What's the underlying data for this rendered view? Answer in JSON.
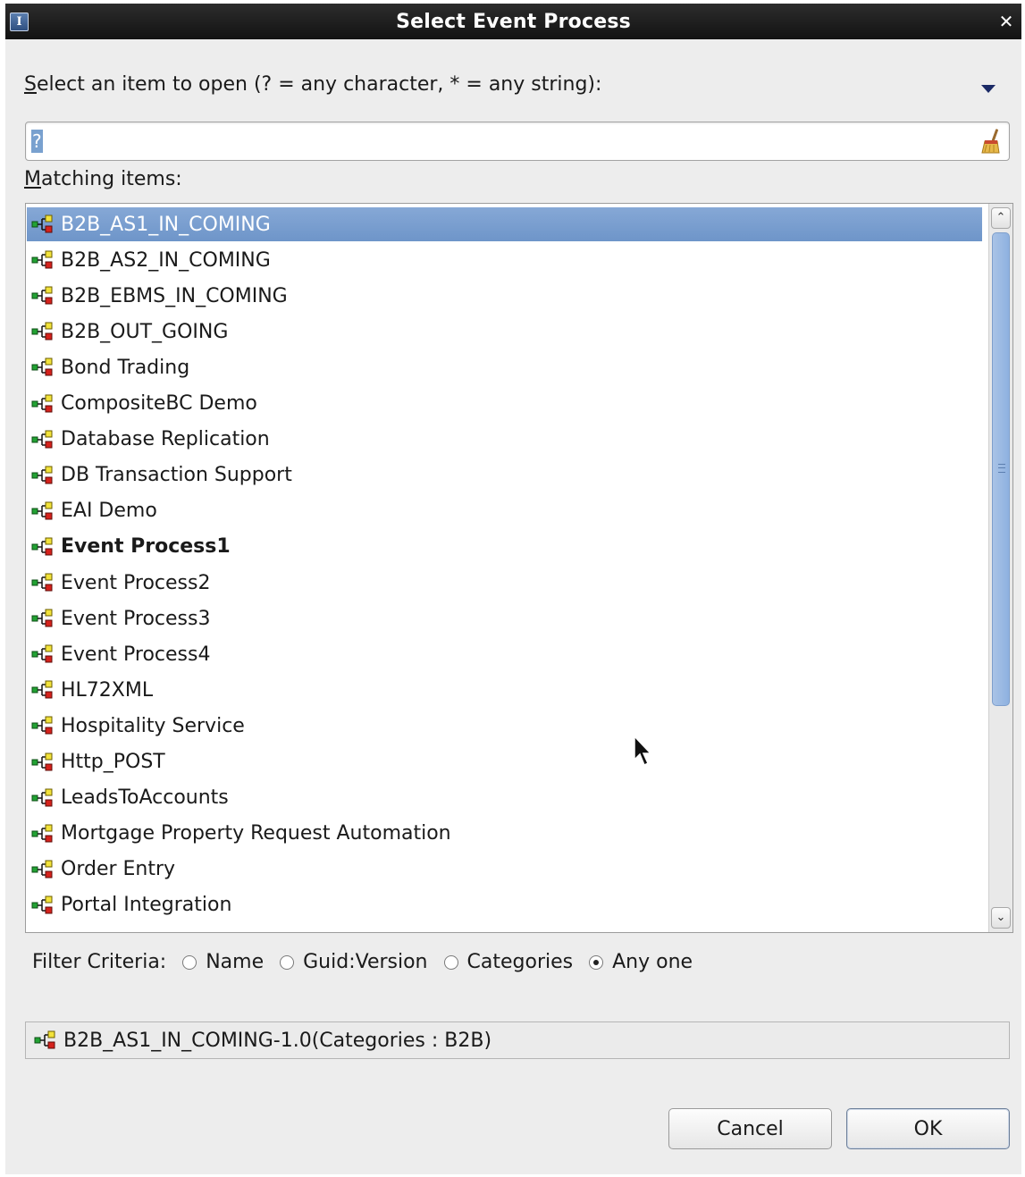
{
  "dialog": {
    "title": "Select Event Process",
    "app_icon_letter": "I"
  },
  "prompt": {
    "mnemonic": "S",
    "rest": "elect an item to open (? = any character, * = any string):"
  },
  "search": {
    "value": "?"
  },
  "matching": {
    "mnemonic": "M",
    "rest": "atching items:"
  },
  "items": [
    {
      "label": "B2B_AS1_IN_COMING",
      "selected": true,
      "bold": false
    },
    {
      "label": "B2B_AS2_IN_COMING",
      "selected": false,
      "bold": false
    },
    {
      "label": "B2B_EBMS_IN_COMING",
      "selected": false,
      "bold": false
    },
    {
      "label": "B2B_OUT_GOING",
      "selected": false,
      "bold": false
    },
    {
      "label": "Bond Trading",
      "selected": false,
      "bold": false
    },
    {
      "label": "CompositeBC Demo",
      "selected": false,
      "bold": false
    },
    {
      "label": "Database Replication",
      "selected": false,
      "bold": false
    },
    {
      "label": "DB Transaction Support",
      "selected": false,
      "bold": false
    },
    {
      "label": "EAI Demo",
      "selected": false,
      "bold": false
    },
    {
      "label": "Event Process1",
      "selected": false,
      "bold": true
    },
    {
      "label": "Event Process2",
      "selected": false,
      "bold": false
    },
    {
      "label": "Event Process3",
      "selected": false,
      "bold": false
    },
    {
      "label": "Event Process4",
      "selected": false,
      "bold": false
    },
    {
      "label": "HL72XML",
      "selected": false,
      "bold": false
    },
    {
      "label": "Hospitality Service",
      "selected": false,
      "bold": false
    },
    {
      "label": "Http_POST",
      "selected": false,
      "bold": false
    },
    {
      "label": "LeadsToAccounts",
      "selected": false,
      "bold": false
    },
    {
      "label": "Mortgage Property Request Automation",
      "selected": false,
      "bold": false
    },
    {
      "label": "Order Entry",
      "selected": false,
      "bold": false
    },
    {
      "label": "Portal Integration",
      "selected": false,
      "bold": false
    }
  ],
  "filter": {
    "label": "Filter Criteria:",
    "options": [
      {
        "label": "Name",
        "checked": false
      },
      {
        "label": "Guid:Version",
        "checked": false
      },
      {
        "label": "Categories",
        "checked": false
      },
      {
        "label": "Any one",
        "checked": true
      }
    ]
  },
  "status": {
    "text": "B2B_AS1_IN_COMING-1.0(Categories : B2B)"
  },
  "buttons": {
    "cancel": "Cancel",
    "ok": "OK"
  },
  "icons": {
    "app": "app-icon",
    "close": "close-icon",
    "history": "dropdown-arrow-icon",
    "clear": "broom-icon",
    "item": "event-process-icon",
    "scroll_up": "scroll-up-icon",
    "scroll_down": "scroll-down-icon"
  },
  "colors": {
    "selection": "#7a9fd0",
    "dialog_bg": "#ededed",
    "titlebar": "#1c1c1c",
    "scroll_thumb": "#9dbbe4"
  }
}
